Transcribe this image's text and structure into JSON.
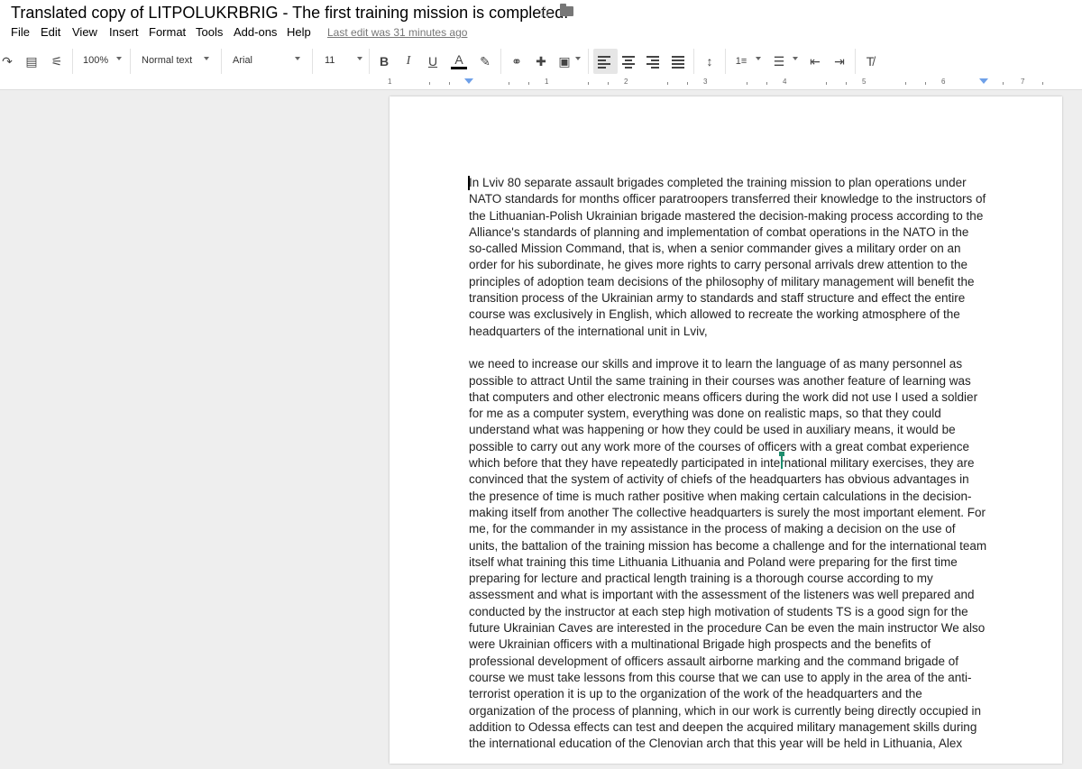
{
  "title": "Translated copy of LITPOLUKRBRIG - The first training mission is completed!",
  "star_icon": "star-icon",
  "folder_icon": "folder-icon",
  "menu": [
    "File",
    "Edit",
    "View",
    "Insert",
    "Format",
    "Tools",
    "Add-ons",
    "Help"
  ],
  "last_edit": "Last edit was 31 minutes ago",
  "toolbar": {
    "zoom": "100%",
    "style": "Normal text",
    "font": "Arial",
    "size": "11",
    "bold": "B",
    "italic": "I",
    "underline": "U",
    "text_color": "A"
  },
  "ruler": [
    "1",
    "1",
    "2",
    "3",
    "4",
    "5",
    "6",
    "7"
  ],
  "paragraphs": [
    "In Lviv 80 separate assault brigades completed the training mission to plan operations under NATO standards for months officer paratroopers transferred their knowledge to the instructors of the Lithuanian-Polish Ukrainian brigade mastered the decision-making process according to the Alliance's standards of planning and implementation of combat operations in the NATO in the so-called Mission Command, that is, when a senior commander gives a military order on an order for his subordinate, he gives more rights to carry personal arrivals drew attention to the principles of adoption team decisions of the philosophy of military management will benefit the transition process of the Ukrainian army to standards and staff structure and effect the entire course was exclusively in English, which allowed to recreate the working atmosphere of the headquarters of the international unit in Lviv,",
    "we need to increase our skills and improve it to learn the language of as many personnel as possible to attract Until the same training in their courses was another feature of learning was that computers and other electronic means officers during the work did not use I used a soldier for me as a computer system, everything was done on realistic maps, so that they could understand what was happening or how they could be used in auxiliary means, it would be possible to carry out any work more of the courses of officers with a great combat experience which before that they have repeatedly participated in international military exercises, they are convinced that the system of activity of chiefs of the headquarters has obvious advantages in the presence of time is much rather positive when making certain calculations in the decision-making itself from another The collective headquarters is surely the most important element. For me, for the commander in my assistance in the process of making a decision on the use of units, the battalion of the training mission has become a challenge and for the international team itself what training this time Lithuania Lithuania and Poland were preparing for the first time preparing for lecture and practical length training is a thorough course according to my assessment and what is important with the assessment of the listeners was well prepared and conducted by the instructor at each step high motivation of students TS is a good sign for the future Ukrainian Caves are interested in the procedure Can be even the main instructor We also were Ukrainian officers with a multinational Brigade high prospects and the benefits of professional development of officers assault airborne marking and the command brigade of course we must take lessons from this course that we can use to apply in the area of the anti-terrorist operation it is up to the organization of the work of the headquarters and the organization of the process of planning, which in our work is currently being directly occupied in addition to Odessa effects can test and deepen the acquired military management skills during the international education of the Clenovian arch that this year will be held in Lithuania, Alex"
  ],
  "accent_color": "#1e8e6e"
}
